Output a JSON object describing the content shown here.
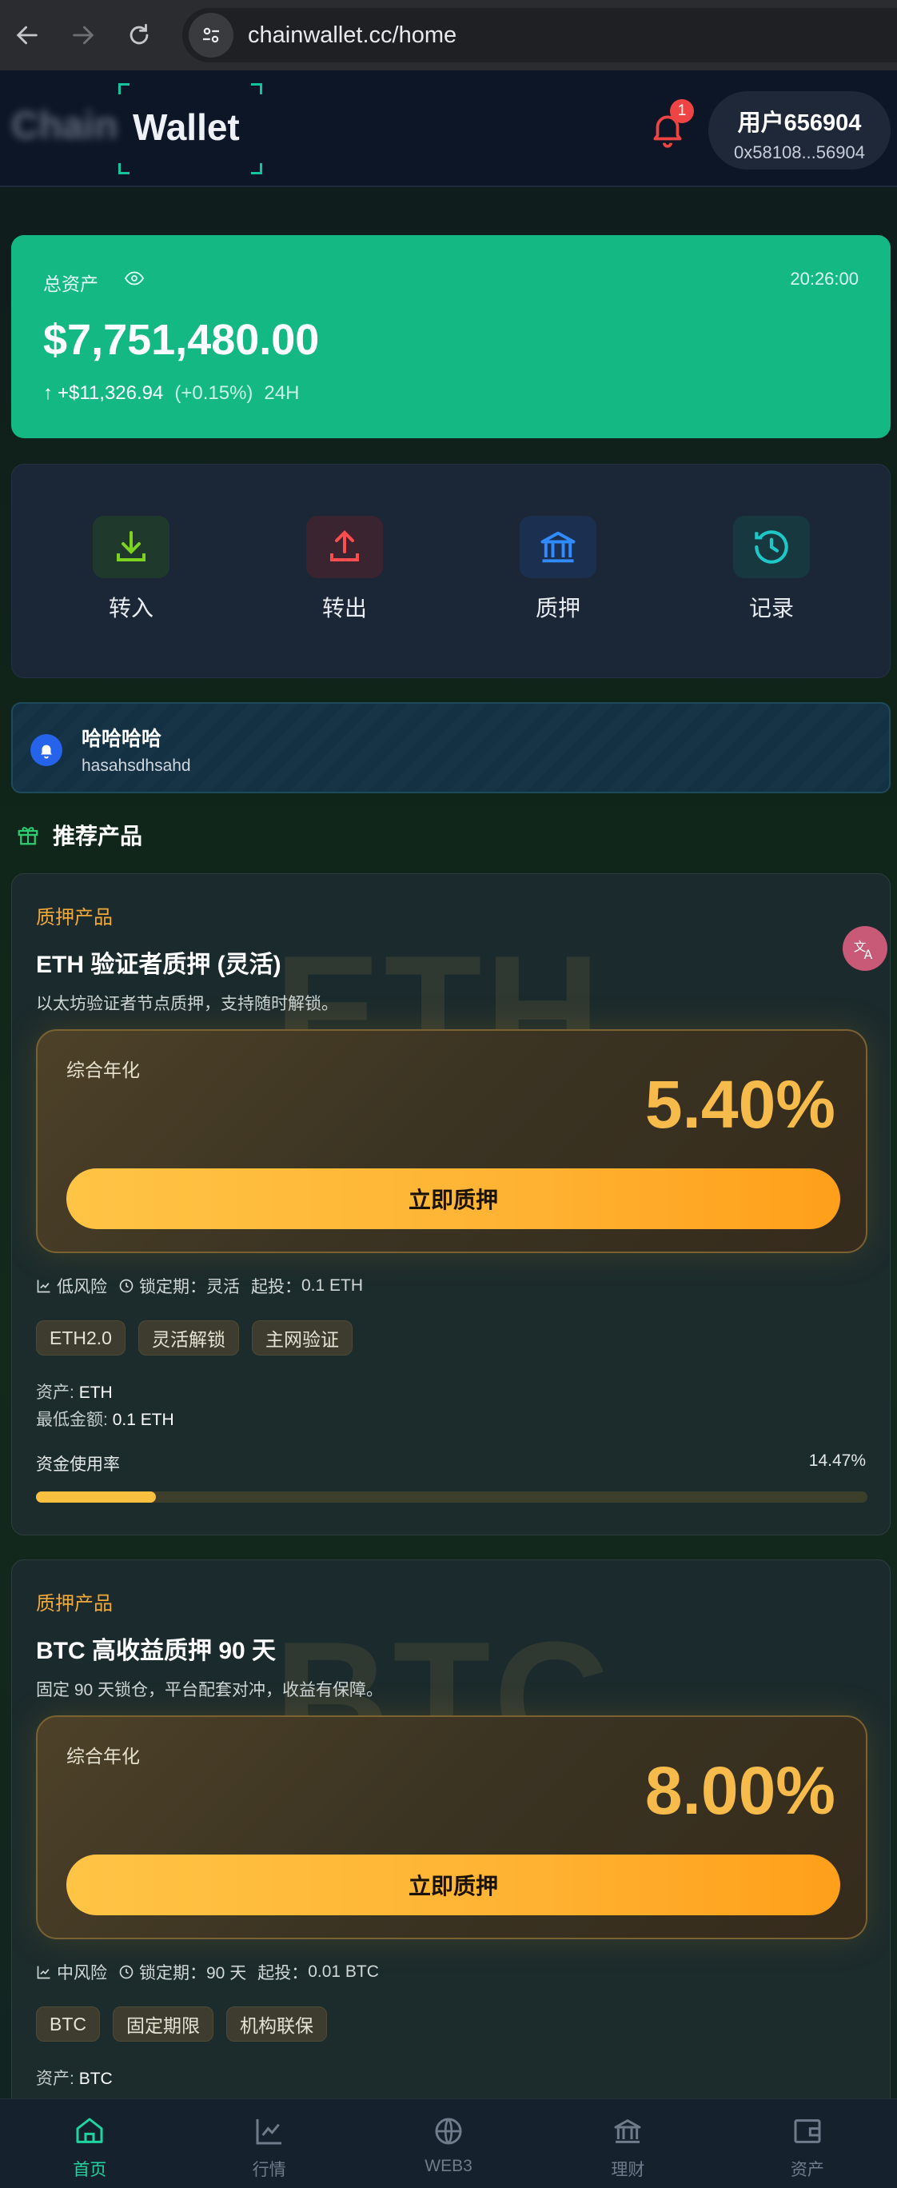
{
  "browser": {
    "url": "chainwallet.cc/home"
  },
  "header": {
    "logo_blur": "Chain",
    "logo": "Wallet",
    "notification_count": "1",
    "user_name": "用户656904",
    "user_address": "0x58108...56904"
  },
  "assets": {
    "label": "总资产",
    "time": "20:26:00",
    "value": "$7,751,480.00",
    "change_amount": "+$11,326.94",
    "change_pct": "(+0.15%)",
    "period": "24H"
  },
  "actions": [
    {
      "label": "转入",
      "icon": "download-icon",
      "color": "#7ed321"
    },
    {
      "label": "转出",
      "icon": "upload-icon",
      "color": "#ff4d4f"
    },
    {
      "label": "质押",
      "icon": "bank-icon",
      "color": "#2f8bff"
    },
    {
      "label": "记录",
      "icon": "clock-history-icon",
      "color": "#1ec8c8"
    }
  ],
  "announcement": {
    "title": "哈哈哈哈",
    "subtitle": "hasahsdhsahd"
  },
  "section": {
    "title": "推荐产品"
  },
  "products": [
    {
      "watermark": "ETH",
      "category": "质押产品",
      "title": "ETH 验证者质押 (灵活)",
      "desc": "以太坊验证者节点质押，支持随时解锁。",
      "apy_label": "综合年化",
      "apy": "5.40%",
      "button": "立即质押",
      "risk": "低风险",
      "lock_label": "锁定期：",
      "lock": "灵活",
      "min_label": "起投：",
      "min": "0.1 ETH",
      "tags": [
        "ETH2.0",
        "灵活解锁",
        "主网验证"
      ],
      "asset_label": "资产:",
      "asset": "ETH",
      "min_amount_label": "最低金额:",
      "min_amount": "0.1 ETH",
      "usage_label": "资金使用率",
      "usage_pct": "14.47%",
      "usage": 14.47
    },
    {
      "watermark": "BTC",
      "category": "质押产品",
      "title": "BTC 高收益质押 90 天",
      "desc": "固定 90 天锁仓，平台配套对冲，收益有保障。",
      "apy_label": "综合年化",
      "apy": "8.00%",
      "button": "立即质押",
      "risk": "中风险",
      "lock_label": "锁定期：",
      "lock": "90 天",
      "min_label": "起投：",
      "min": "0.01 BTC",
      "tags": [
        "BTC",
        "固定期限",
        "机构联保"
      ],
      "asset_label": "资产:",
      "asset": "BTC"
    }
  ],
  "bottom_nav": [
    {
      "label": "首页",
      "icon": "home-icon",
      "active": true
    },
    {
      "label": "行情",
      "icon": "chart-line-icon",
      "active": false
    },
    {
      "label": "WEB3",
      "icon": "globe-icon",
      "active": false
    },
    {
      "label": "理财",
      "icon": "bank-icon",
      "active": false
    },
    {
      "label": "资产",
      "icon": "wallet-icon",
      "active": false
    }
  ]
}
